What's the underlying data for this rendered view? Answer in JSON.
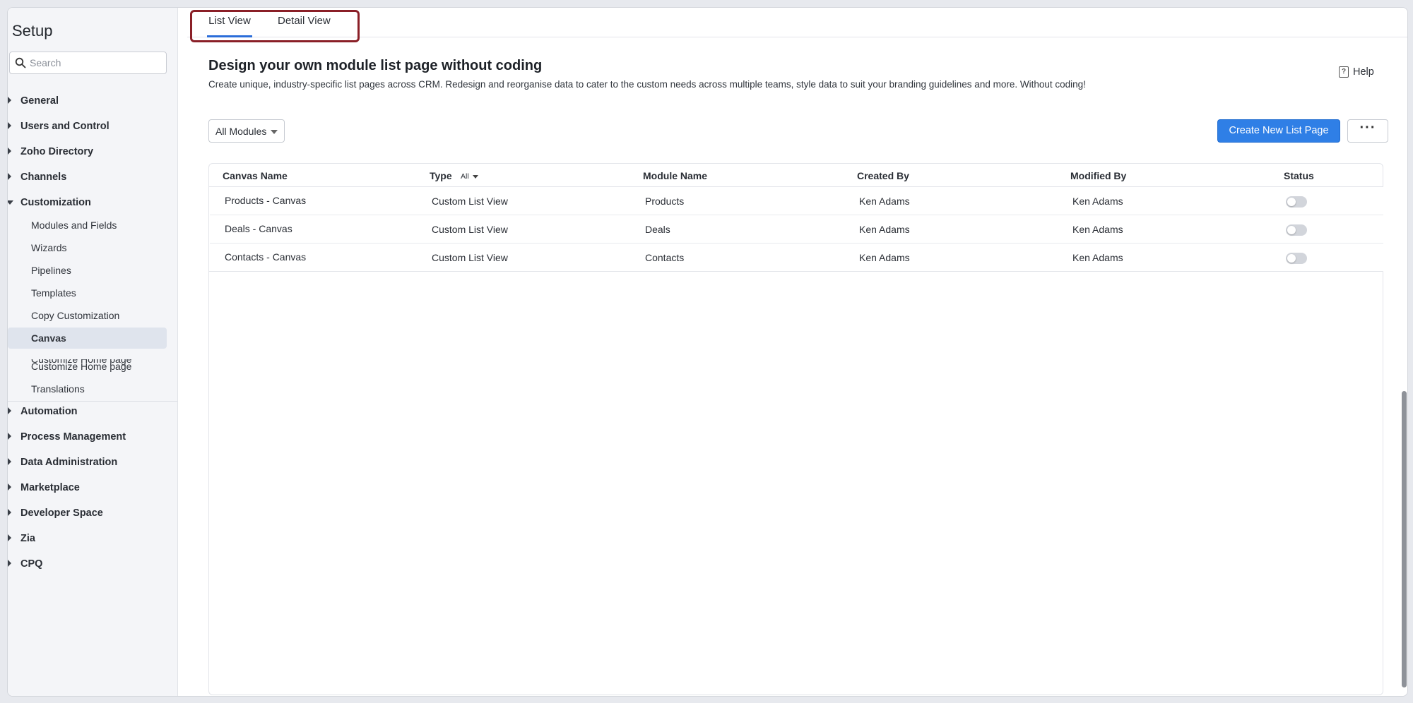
{
  "sidebar": {
    "title": "Setup",
    "search_placeholder": "Search",
    "sections_top": [
      "General",
      "Users and Control",
      "Zoho Directory",
      "Channels",
      "Customization"
    ],
    "customization_items": [
      "Modules and Fields",
      "Wizards",
      "Pipelines",
      "Templates",
      "Copy Customization",
      "Canvas",
      "Customize Home page",
      "Translations"
    ],
    "clipped_item": "Customize Home page",
    "sections_bottom": [
      "Automation",
      "Process Management",
      "Data Administration",
      "Marketplace",
      "Developer Space",
      "Zia",
      "CPQ"
    ]
  },
  "tabs": [
    "List View",
    "Detail View"
  ],
  "main": {
    "heading": "Design your own module list page without coding",
    "subtext": "Create unique, industry-specific list pages across CRM. Redesign and reorganise data to cater to the custom needs across multiple teams, style data to suit your branding guidelines and more. Without coding!",
    "help_label": "Help",
    "module_filter": "All Modules",
    "create_button": "Create New List Page",
    "more_button": "···"
  },
  "table": {
    "columns": [
      "Canvas Name",
      "Type",
      "Module Name",
      "Created By",
      "Modified By",
      "Status"
    ],
    "type_filter": "All",
    "rows": [
      {
        "canvas_name": "Products - Canvas",
        "type": "Custom List View",
        "module": "Products",
        "created_by": "Ken Adams",
        "modified_by": "Ken Adams",
        "status": "off"
      },
      {
        "canvas_name": "Deals - Canvas",
        "type": "Custom List View",
        "module": "Deals",
        "created_by": "Ken Adams",
        "modified_by": "Ken Adams",
        "status": "off"
      },
      {
        "canvas_name": "Contacts - Canvas",
        "type": "Custom List View",
        "module": "Contacts",
        "created_by": "Ken Adams",
        "modified_by": "Ken Adams",
        "status": "off"
      }
    ]
  },
  "colors": {
    "accent": "#2f7fe6",
    "tab_highlight": "#8a1f27",
    "sidebar_active": "#dfe4ed"
  }
}
